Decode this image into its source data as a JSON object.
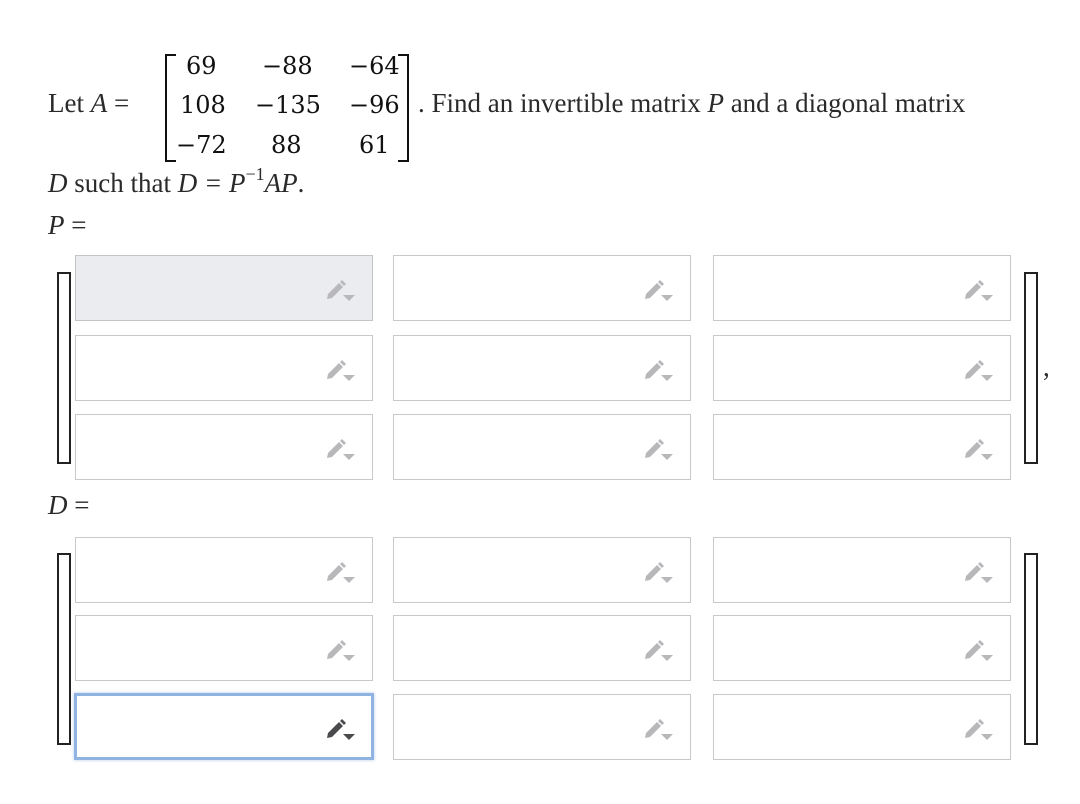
{
  "problem": {
    "let": "Let",
    "var_A": "A",
    "equals": "=",
    "sentence_tail": ". Find an invertible matrix",
    "var_P": "P",
    "and_a": "and a diagonal matrix",
    "var_D": "D",
    "such_that": "such that",
    "eq_lhs": "D =",
    "eq_P": "P",
    "eq_sup": "−1",
    "eq_AP": "AP",
    "period": ".",
    "matrix_A": [
      [
        "69",
        "−88",
        "−64"
      ],
      [
        "108",
        "−135",
        "−96"
      ],
      [
        "−72",
        "88",
        "61"
      ]
    ]
  },
  "answer_P": {
    "label_var": "P",
    "label_eq": "=",
    "trailing": ",",
    "cells": [
      [
        "",
        "",
        ""
      ],
      [
        "",
        "",
        ""
      ],
      [
        "",
        "",
        ""
      ]
    ]
  },
  "answer_D": {
    "label_var": "D",
    "label_eq": "=",
    "cells": [
      [
        "",
        "",
        ""
      ],
      [
        "",
        "",
        ""
      ],
      [
        "",
        "",
        ""
      ]
    ]
  },
  "icons": {
    "cell_tool": "pencil-dropdown-icon"
  },
  "colors": {
    "focus_border": "#8fb4e2",
    "shaded_cell": "#ebecef",
    "cell_border": "#c9c9c9"
  }
}
